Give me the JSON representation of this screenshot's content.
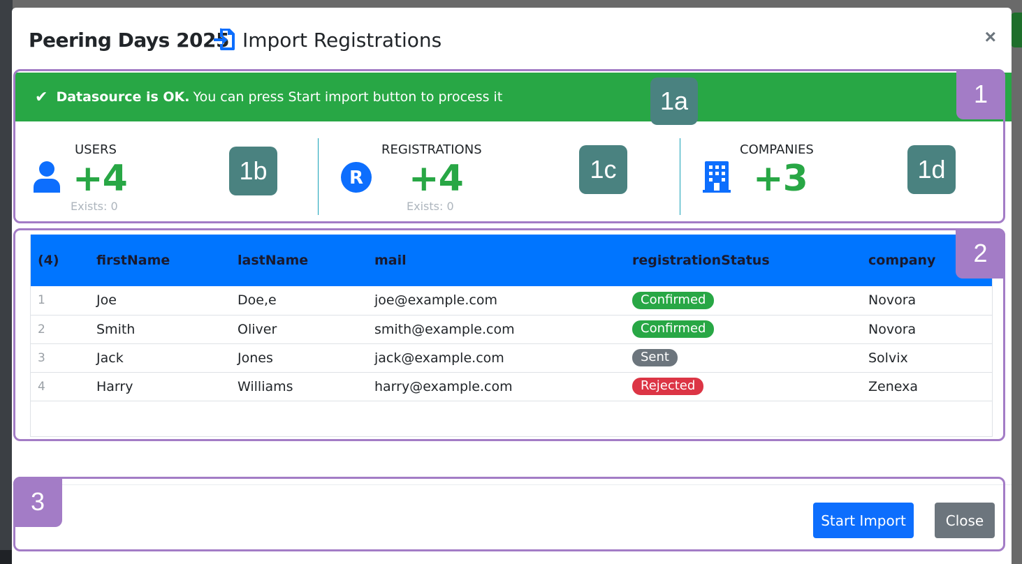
{
  "header": {
    "event_title": "Peering Days 2025",
    "dialog_title": "Import Registrations",
    "close_symbol": "×"
  },
  "alert": {
    "strong": "Datasource is OK.",
    "text": "You can press Start import button to process it",
    "color": "#28a745"
  },
  "stats": {
    "users": {
      "label": "USERS",
      "value": "+4",
      "exists": "Exists: 0",
      "icon": "user-icon"
    },
    "registrations": {
      "label": "REGISTRATIONS",
      "value": "+4",
      "exists": "Exists: 0",
      "icon": "registered-icon"
    },
    "companies": {
      "label": "COMPANIES",
      "value": "+3",
      "icon": "building-icon"
    }
  },
  "table": {
    "headers": [
      "(4)",
      "firstName",
      "lastName",
      "mail",
      "registrationStatus",
      "company"
    ],
    "rows": [
      {
        "idx": "1",
        "firstName": "Joe",
        "lastName": "Doe,e",
        "mail": "joe@example.com",
        "status": "Confirmed",
        "company": "Novora"
      },
      {
        "idx": "2",
        "firstName": "Smith",
        "lastName": "Oliver",
        "mail": "smith@example.com",
        "status": "Confirmed",
        "company": "Novora"
      },
      {
        "idx": "3",
        "firstName": "Jack",
        "lastName": "Jones",
        "mail": "jack@example.com",
        "status": "Sent",
        "company": "Solvix"
      },
      {
        "idx": "4",
        "firstName": "Harry",
        "lastName": "Williams",
        "mail": "harry@example.com",
        "status": "Rejected",
        "company": "Zenexa"
      }
    ],
    "status_colors": {
      "Confirmed": "#28a745",
      "Sent": "#6c757d",
      "Rejected": "#dc3545"
    }
  },
  "footer": {
    "start_import": "Start Import",
    "close": "Close"
  },
  "callouts": {
    "c1": "1",
    "c1a": "1a",
    "c1b": "1b",
    "c1c": "1c",
    "c1d": "1d",
    "c2": "2",
    "c3": "3"
  },
  "colors": {
    "primary": "#0d6efd",
    "table_header": "#0075ff",
    "success": "#28a745",
    "callout_frame": "#a37cc6",
    "callout_sub": "#4a8280"
  }
}
